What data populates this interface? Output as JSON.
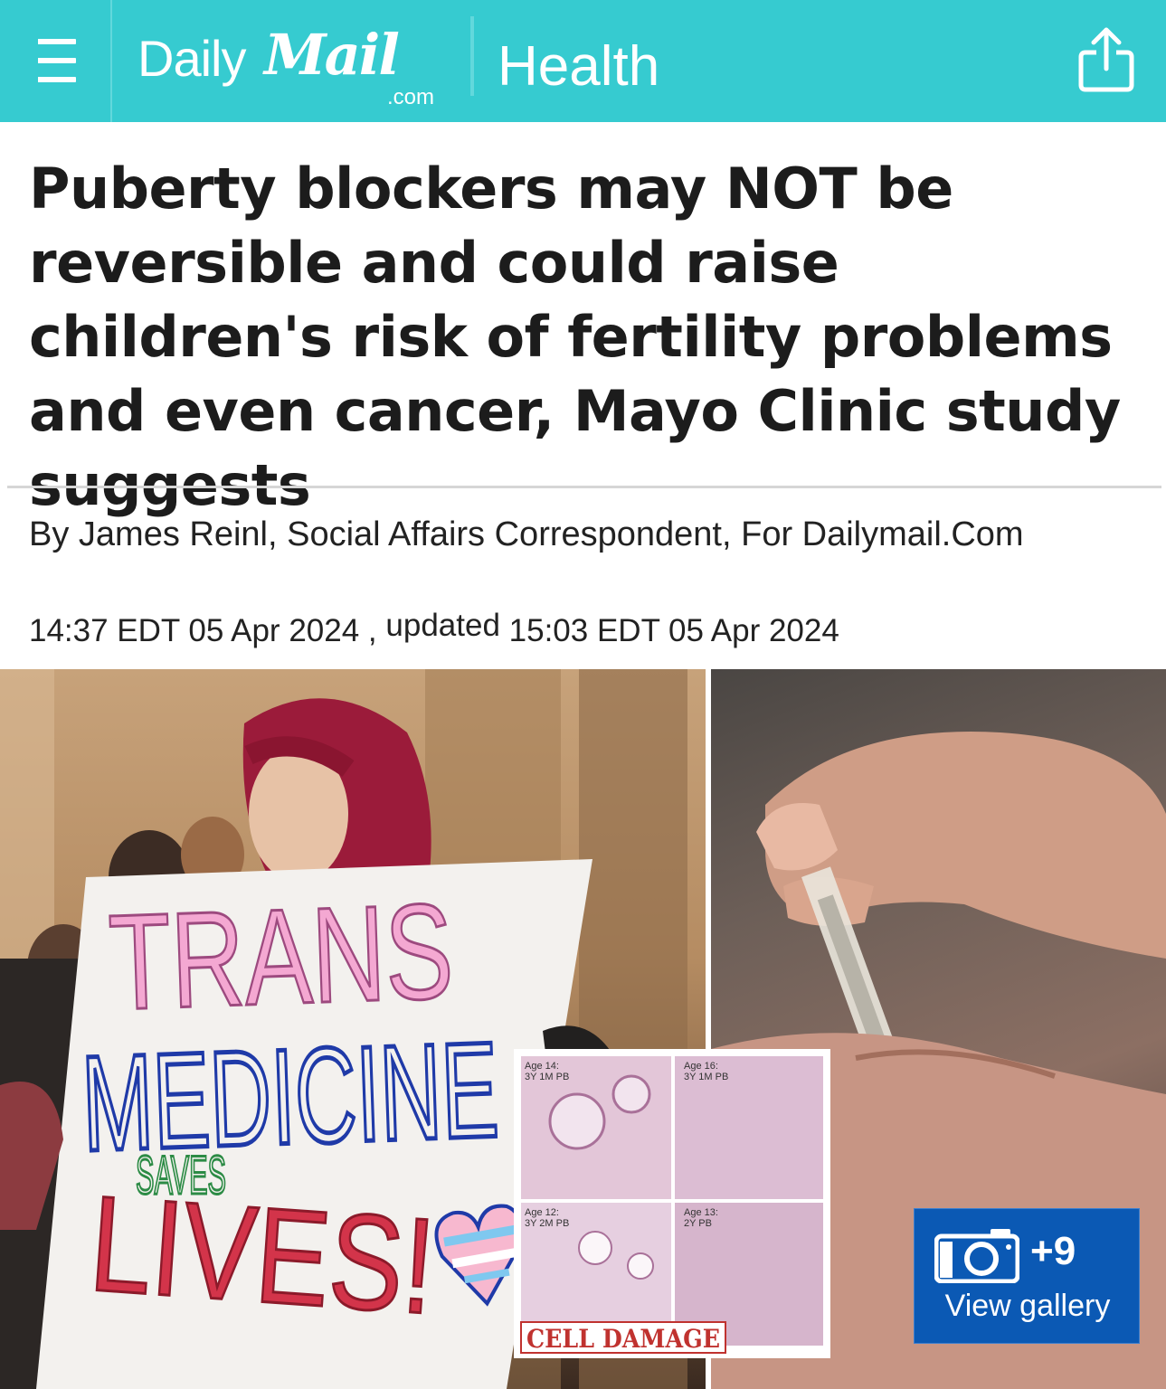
{
  "header": {
    "logo_daily": "Daily",
    "logo_mail": "Mail",
    "logo_com": ".com",
    "section": "Health",
    "bg_color": "#36cbd0"
  },
  "article": {
    "headline": "Puberty blockers may NOT be reversible and could raise children's risk of fertility problems and even cancer, Mayo Clinic study suggests",
    "byline": "By James Reinl, Social Affairs Correspondent, For Dailymail.Com",
    "published": "14:37 EDT 05 Apr 2024",
    "separator": ",",
    "updated_label": "updated",
    "updated": "15:03 EDT 05 Apr 2024"
  },
  "image": {
    "sign_line1": "TRANS",
    "sign_line2": "MEDICINE",
    "sign_line3": "SAVES",
    "sign_line4": "LIVES!",
    "inset_label": "CELL DAMAGE",
    "inset_panels": [
      {
        "age": "Age 14:",
        "code": "3Y 1M PB"
      },
      {
        "age": "Age 16:",
        "code": "3Y 1M PB"
      },
      {
        "age": "Age 12:",
        "code": "3Y 2M PB"
      },
      {
        "age": "Age 13:",
        "code": "2Y PB"
      }
    ]
  },
  "gallery": {
    "count": "+9",
    "label": "View gallery",
    "icon": "camera-icon",
    "bg_color": "#0b59b4"
  }
}
